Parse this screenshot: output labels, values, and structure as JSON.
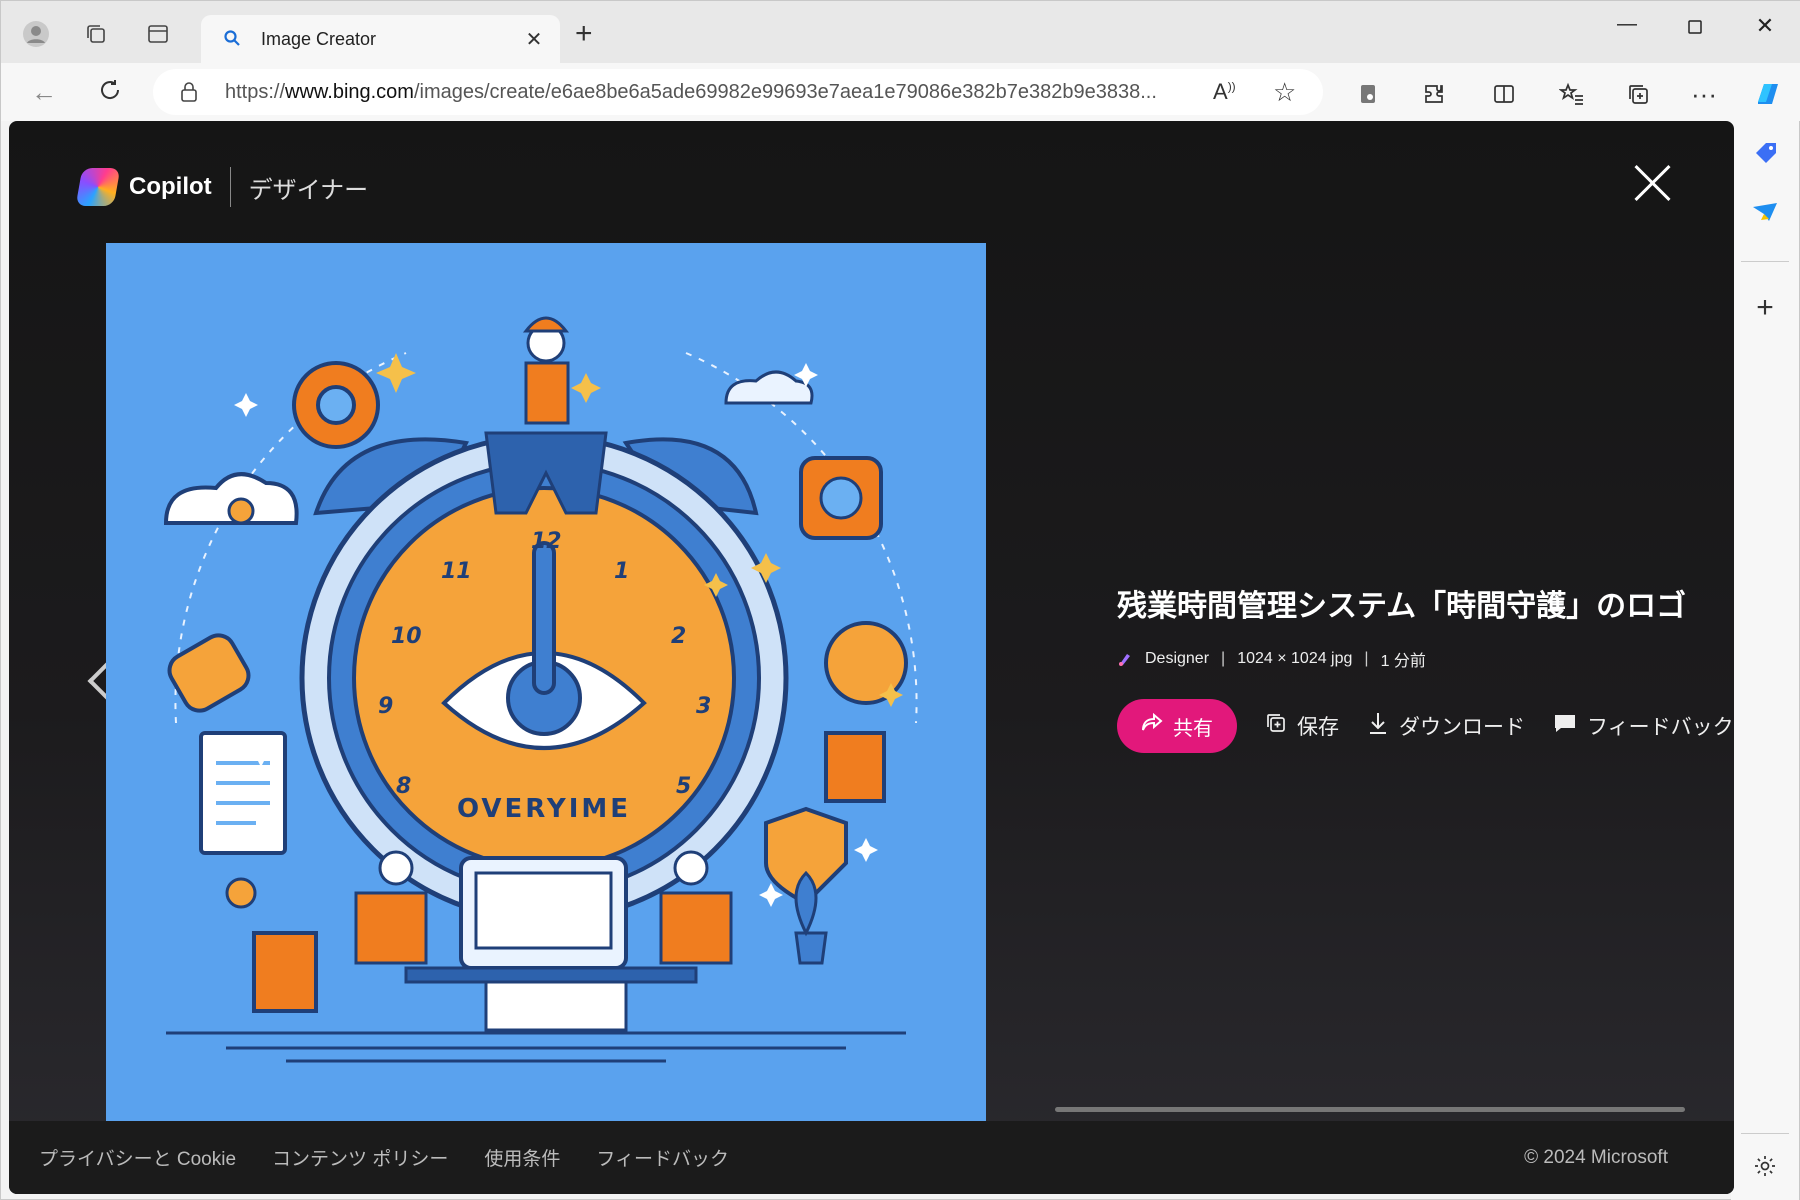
{
  "browser": {
    "tab_title": "Image Creator",
    "url_prefix": "https://",
    "url_host": "www.bing.com",
    "url_path": "/images/create/e6ae8be6a5ade69982e99693e7aea1e79086e382b7e382b9e3838..."
  },
  "page": {
    "brand_name": "Copilot",
    "brand_sub": "デザイナー",
    "image_title": "残業時間管理システム「時間守護」のロゴ",
    "meta_source": "Designer",
    "meta_size": "1024 × 1024 jpg",
    "meta_time": "1 分前",
    "share_label": "共有",
    "save_label": "保存",
    "download_label": "ダウンロード",
    "feedback_label": "フィードバック",
    "art_text": "OVERYIME",
    "clock_numbers": [
      "12",
      "1",
      "2",
      "3",
      "5",
      "8",
      "9",
      "10",
      "11"
    ]
  },
  "footer": {
    "links": [
      "プライバシーと Cookie",
      "コンテンツ ポリシー",
      "使用条件",
      "フィードバック"
    ],
    "copyright": "© 2024 Microsoft"
  },
  "colors": {
    "accent": "#e2187b",
    "art_bg": "#5aa2ee",
    "clock_face": "#f5a33a"
  }
}
